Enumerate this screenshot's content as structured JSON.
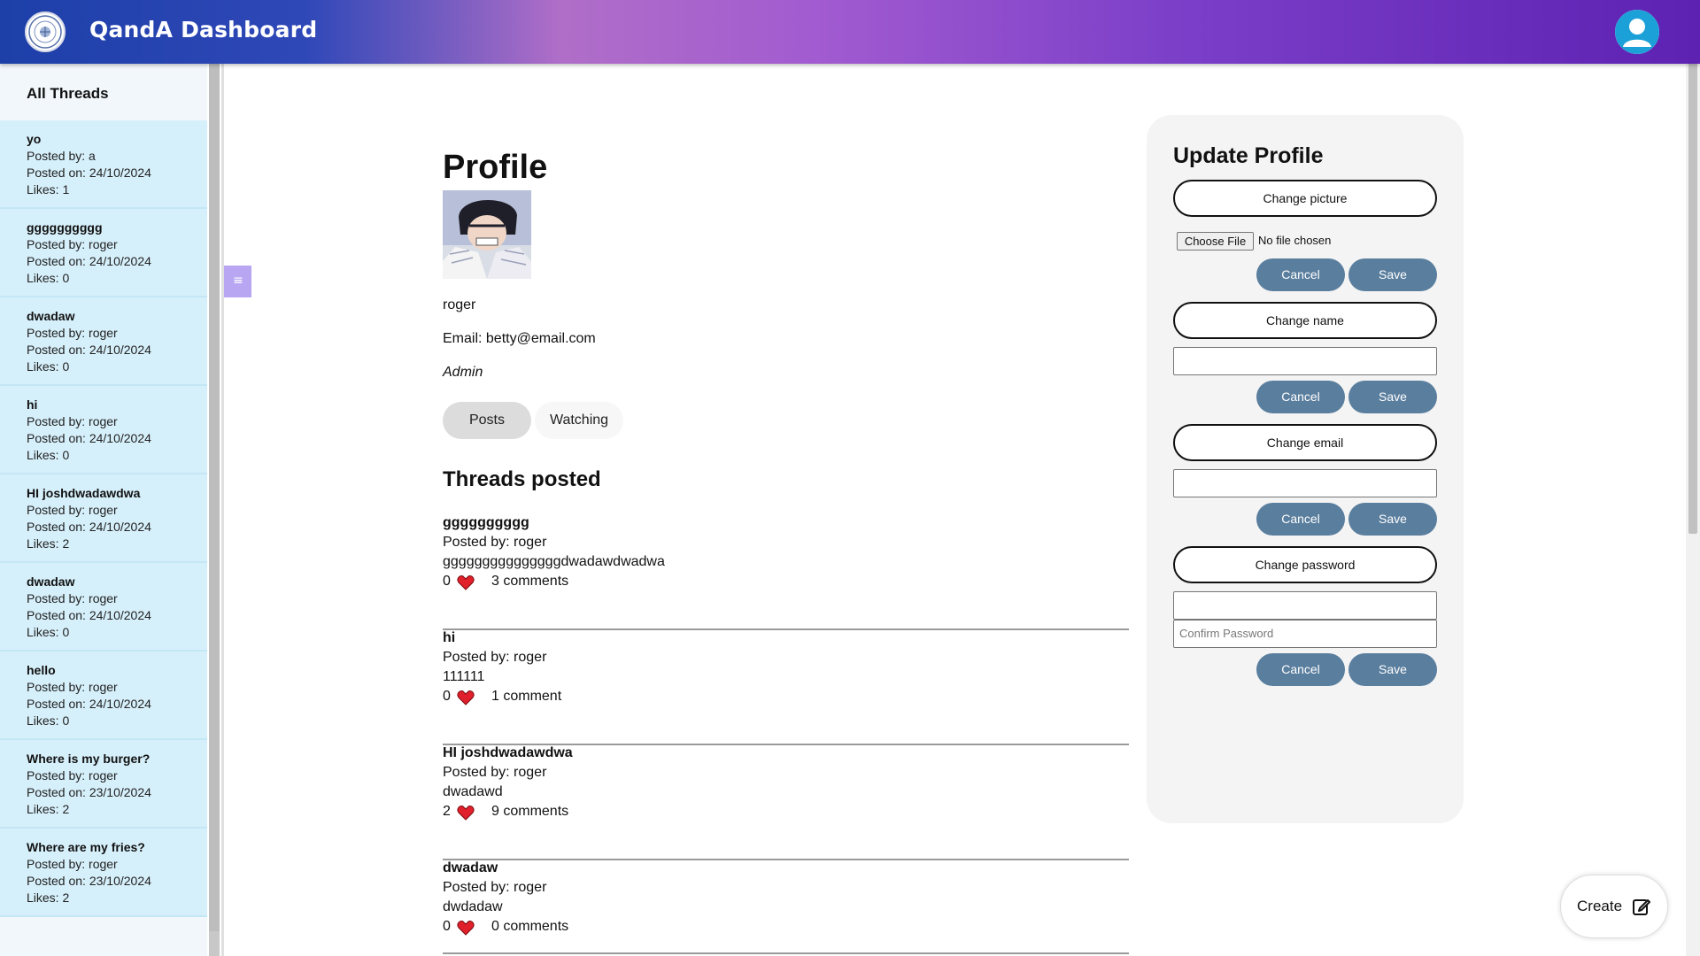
{
  "header": {
    "title": "QandA Dashboard"
  },
  "sidebar": {
    "title": "All Threads",
    "threads": [
      {
        "title": "yo",
        "author": "Posted by: a",
        "date": "Posted on: 24/10/2024",
        "likes": "Likes: 1"
      },
      {
        "title": "gggggggggg",
        "author": "Posted by: roger",
        "date": "Posted on: 24/10/2024",
        "likes": "Likes: 0"
      },
      {
        "title": "dwadaw",
        "author": "Posted by: roger",
        "date": "Posted on: 24/10/2024",
        "likes": "Likes: 0"
      },
      {
        "title": "hi",
        "author": "Posted by: roger",
        "date": "Posted on: 24/10/2024",
        "likes": "Likes: 0"
      },
      {
        "title": "HI joshdwadawdwa",
        "author": "Posted by: roger",
        "date": "Posted on: 24/10/2024",
        "likes": "Likes: 2"
      },
      {
        "title": "dwadaw",
        "author": "Posted by: roger",
        "date": "Posted on: 24/10/2024",
        "likes": "Likes: 0"
      },
      {
        "title": "hello",
        "author": "Posted by: roger",
        "date": "Posted on: 24/10/2024",
        "likes": "Likes: 0"
      },
      {
        "title": "Where is my burger?",
        "author": "Posted by: roger",
        "date": "Posted on: 23/10/2024",
        "likes": "Likes: 2"
      },
      {
        "title": "Where are my fries?",
        "author": "Posted by: roger",
        "date": "Posted on: 23/10/2024",
        "likes": "Likes: 2"
      }
    ]
  },
  "profile": {
    "heading": "Profile",
    "name": "roger",
    "email": "Email: betty@email.com",
    "role": "Admin",
    "tabs": {
      "posts": "Posts",
      "watching": "Watching"
    },
    "section_heading": "Threads posted",
    "posts": [
      {
        "title": "gggggggggg",
        "author": "Posted by: roger",
        "body": "gggggggggggggggdwadawdwadwa",
        "likes": "0",
        "comments": "3 comments"
      },
      {
        "title": "hi",
        "author": "Posted by: roger",
        "body": "111111",
        "likes": "0",
        "comments": "1 comment"
      },
      {
        "title": "HI joshdwadawdwa",
        "author": "Posted by: roger",
        "body": "dwadawd",
        "likes": "2",
        "comments": "9 comments"
      },
      {
        "title": "dwadaw",
        "author": "Posted by: roger",
        "body": "dwdadaw",
        "likes": "0",
        "comments": "0 comments"
      }
    ]
  },
  "update": {
    "title": "Update Profile",
    "change_picture": "Change picture",
    "choose_file": "Choose File",
    "no_file": "No file chosen",
    "change_name": "Change name",
    "change_email": "Change email",
    "change_password": "Change password",
    "confirm_placeholder": "Confirm Password",
    "cancel": "Cancel",
    "save": "Save"
  },
  "create": {
    "label": "Create"
  },
  "colors": {
    "header_gradient_start": "#1d3fa8",
    "header_gradient_mid": "#b06ec8",
    "header_gradient_end": "#5d22b2",
    "thread_item_bg": "#d6f0fb",
    "save_cancel_bg": "#5a7e9e",
    "heart": "#e0202a"
  },
  "icons": {
    "logo": "university-seal-logo",
    "avatar": "user-avatar-icon",
    "toggle": "hamburger-icon",
    "like": "heart-icon",
    "create": "edit-icon"
  }
}
